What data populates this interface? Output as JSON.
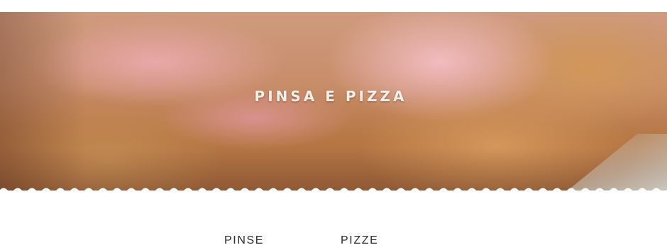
{
  "hero": {
    "title": "PINSA E PIZZA"
  },
  "tabs": [
    {
      "label": "PINSE"
    },
    {
      "label": "PIZZE"
    }
  ],
  "colors": {
    "hero_title": "#f4eee8",
    "tab_text": "#2b2b2b",
    "background": "#ffffff"
  }
}
